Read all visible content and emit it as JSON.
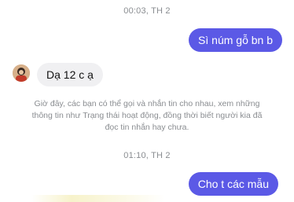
{
  "messages": {
    "timestamp_1": "00:03, TH 2",
    "outgoing_1": "Sì núm gỗ bn b",
    "incoming_1": "Dạ 12 c ạ",
    "system_note": [
      "Giờ đây, các bạn có thể gọi và nhắn tin cho nhau, xem những",
      "thông tin như Trạng thái hoạt động, đồng thời biết người kia đã",
      "đọc tin nhắn hay chưa."
    ],
    "timestamp_2": "01:10, TH 2",
    "outgoing_2": "Cho t các mẫu"
  },
  "colors": {
    "outgoing_bubble": "#5b59e6",
    "incoming_bubble": "#f0f0f2",
    "meta_text": "#8a8d91"
  },
  "icons": {
    "avatar": "contact-avatar"
  }
}
